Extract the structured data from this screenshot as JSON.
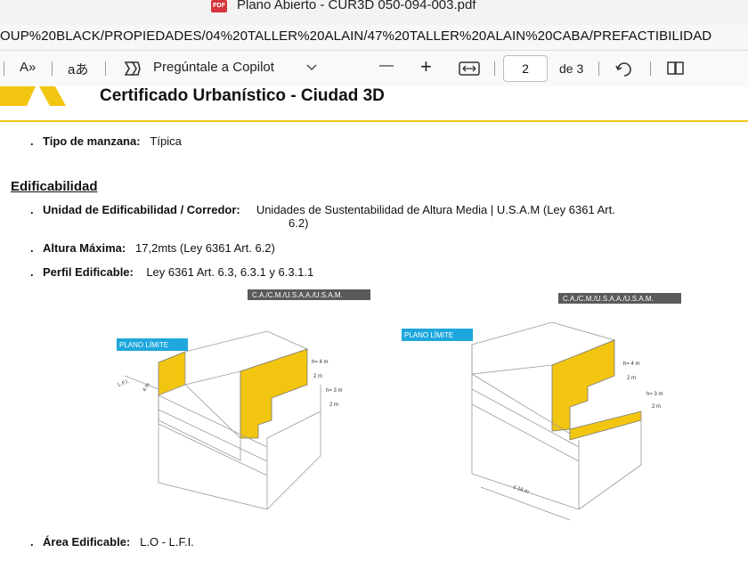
{
  "window": {
    "pdf_badge": "PDF",
    "title": "Plano Abierto - CUR3D 050-094-003.pdf",
    "url": "OUP%20BLACK/PROPIEDADES/04%20TALLER%20ALAIN/47%20TALLER%20ALAIN%20CABA/PREFACTIBILIDAD"
  },
  "toolbar": {
    "read_aloud": "A»",
    "translate": "aあ",
    "copilot_label": "Pregúntale a Copilot",
    "zoom_out": "—",
    "zoom_in": "+",
    "page_current": "2",
    "page_total": "de 3"
  },
  "document": {
    "title": "Certificado Urbanístico - Ciudad 3D",
    "tipo_label": "Tipo de manzana:",
    "tipo_value": "Típica",
    "section_title": "Edificabilidad",
    "unidad_label": "Unidad de Edificabilidad / Corredor:",
    "unidad_value_1": "Unidades de Sustentabilidad de Altura Media | U.S.A.M (Ley 6361 Art.",
    "unidad_value_2": "6.2)",
    "altura_label": "Altura Máxima:",
    "altura_value": "17,2mts (Ley 6361 Art. 6.2)",
    "perfil_label": "Perfil Edificable:",
    "perfil_value": "Ley 6361 Art. 6.3, 6.3.1 y 6.3.1.1",
    "area_label": "Área Edificable:",
    "area_value": "L.O - L.F.I."
  },
  "diagram": {
    "tag_left": "C.A./C.M./U.S.A.A./U.S.A.M.",
    "tag_right": "C.A./C.M./U.S.A.A./U.S.A.M.",
    "plano_left": "PLANO LÍMITE",
    "plano_right": "PLANO LÍMITE",
    "lfi": "L.F.I.",
    "dim_4m": "4 m",
    "dim_h4": "h= 4 m",
    "dim_2m": "2 m",
    "dim_h3": "h= 3 m",
    "dim_16m": "≤ 16 m",
    "colors": {
      "yellow": "#f2c511",
      "plano": "#1ea7dd",
      "tag": "#5a5a5a"
    }
  }
}
